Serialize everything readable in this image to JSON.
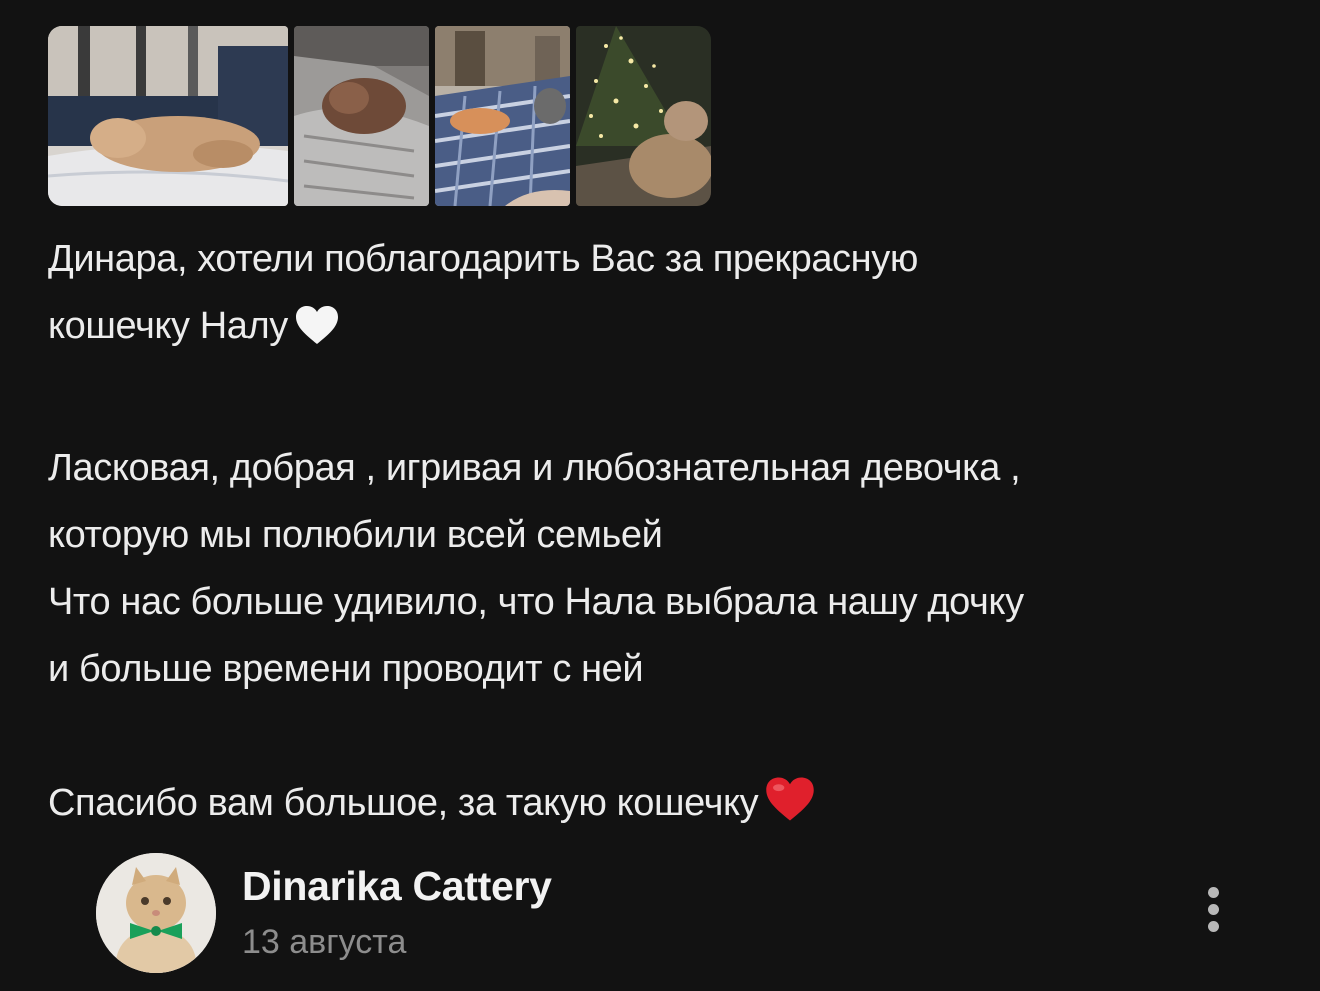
{
  "photos": [
    {
      "alt": "cat-sleeping-on-bed"
    },
    {
      "alt": "cat-on-pillow"
    },
    {
      "alt": "cats-on-blue-blanket"
    },
    {
      "alt": "cat-near-christmas-tree"
    }
  ],
  "review": {
    "line1": "Динара, хотели поблагодарить Вас за прекрасную",
    "line2": "кошечку Налу",
    "line3": "Ласковая, добрая , игривая и любознательная девочка ,",
    "line4": "которую мы полюбили всей семьей",
    "line5": "Что нас больше удивило, что Нала выбрала нашу дочку",
    "line6": "и больше времени проводит с ней",
    "line7": "Спасибо вам большое, за такую кошечку",
    "emoji_white_heart": "white-heart",
    "emoji_red_heart": "red-heart"
  },
  "author": {
    "name": "Dinarika Cattery",
    "date": "13 августа"
  },
  "colors": {
    "background": "#121212",
    "text": "#ececec",
    "secondary_text": "#8d8d8d",
    "red_heart": "#e0202c"
  }
}
